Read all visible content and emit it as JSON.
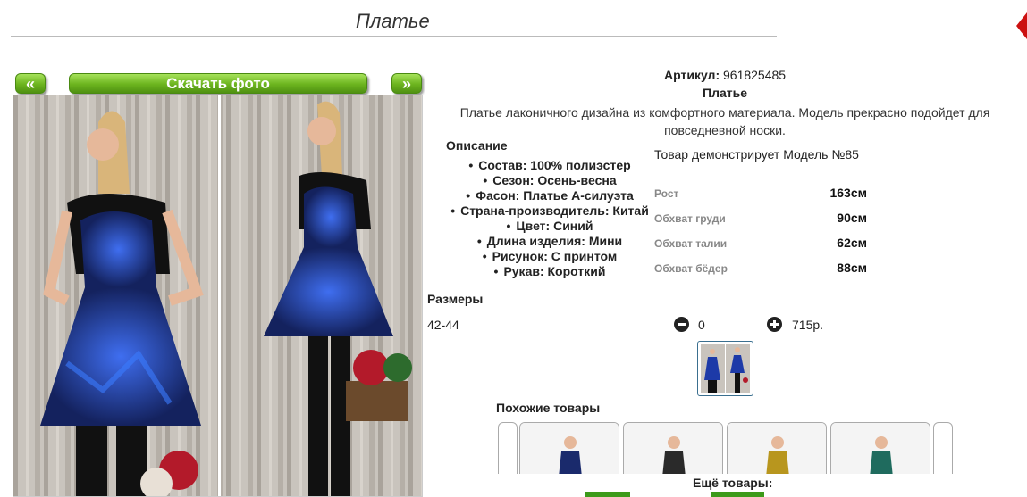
{
  "page": {
    "title": "Платье"
  },
  "gallery": {
    "prev_label": "«",
    "download_label": "Скачать фото",
    "next_label": "»"
  },
  "product": {
    "article_label": "Артикул:",
    "article_value": "961825485",
    "name": "Платье",
    "description": "Платье лаконичного дизайна из комфортного материала. Модель прекрасно подойдет для повседневной носки."
  },
  "specs": {
    "heading": "Описание",
    "items": [
      "Состав: 100% полиэстер",
      "Сезон: Осень-весна",
      "Фасон: Платье А-силуэта",
      "Страна-производитель: Китай",
      "Цвет: Синий",
      "Длина изделия: Мини",
      "Рисунок: С принтом",
      "Рукав: Короткий"
    ]
  },
  "model": {
    "text": "Товар демонстрирует Модель №85",
    "measurements": [
      {
        "label": "Рост",
        "value": "163см"
      },
      {
        "label": "Обхват груди",
        "value": "90см"
      },
      {
        "label": "Обхват талии",
        "value": "62см"
      },
      {
        "label": "Обхват бёдер",
        "value": "88см"
      }
    ]
  },
  "sizes": {
    "heading": "Размеры",
    "rows": [
      {
        "size": "42-44",
        "quantity": "0",
        "price": "715р."
      }
    ]
  },
  "similar": {
    "heading": "Похожие товары",
    "items": [
      {
        "dress_color": "#1a2a6c"
      },
      {
        "dress_color": "#2a2a2a"
      },
      {
        "dress_color": "#b8961e"
      },
      {
        "dress_color": "#1f6b5e"
      }
    ],
    "more_label": "Ещё товары:"
  },
  "colors": {
    "accent_green": "#6cb41e",
    "corner_red": "#cc1111",
    "more_link_green": "#3c9a1a"
  }
}
